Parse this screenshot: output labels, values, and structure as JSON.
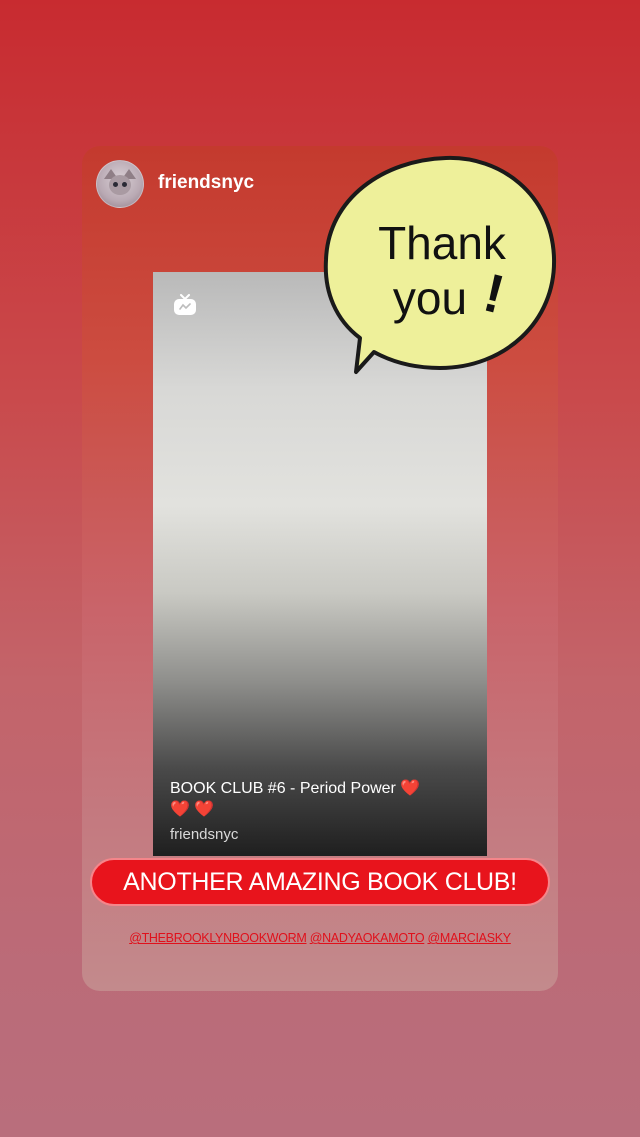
{
  "story": {
    "username": "friendsnyc"
  },
  "video": {
    "title": "BOOK CLUB #6 - Period Power",
    "title_hearts_inline": "❤️",
    "title_hearts_wrap": "❤️ ❤️",
    "username": "friendsnyc",
    "icon": "igtv-icon"
  },
  "sticker": {
    "line1": "Thank",
    "line2": "you",
    "exclaim": "!"
  },
  "banner": {
    "text": "ANOTHER AMAZING BOOK CLUB!"
  },
  "mentions": [
    "@THEBROOKLYNBOOKWORM",
    "@NADYAOKAMOTO",
    "@MARCIASKY"
  ],
  "colors": {
    "banner_bg": "#e8141c",
    "mention_text": "#e0101b",
    "bubble_fill": "#eef09a"
  }
}
